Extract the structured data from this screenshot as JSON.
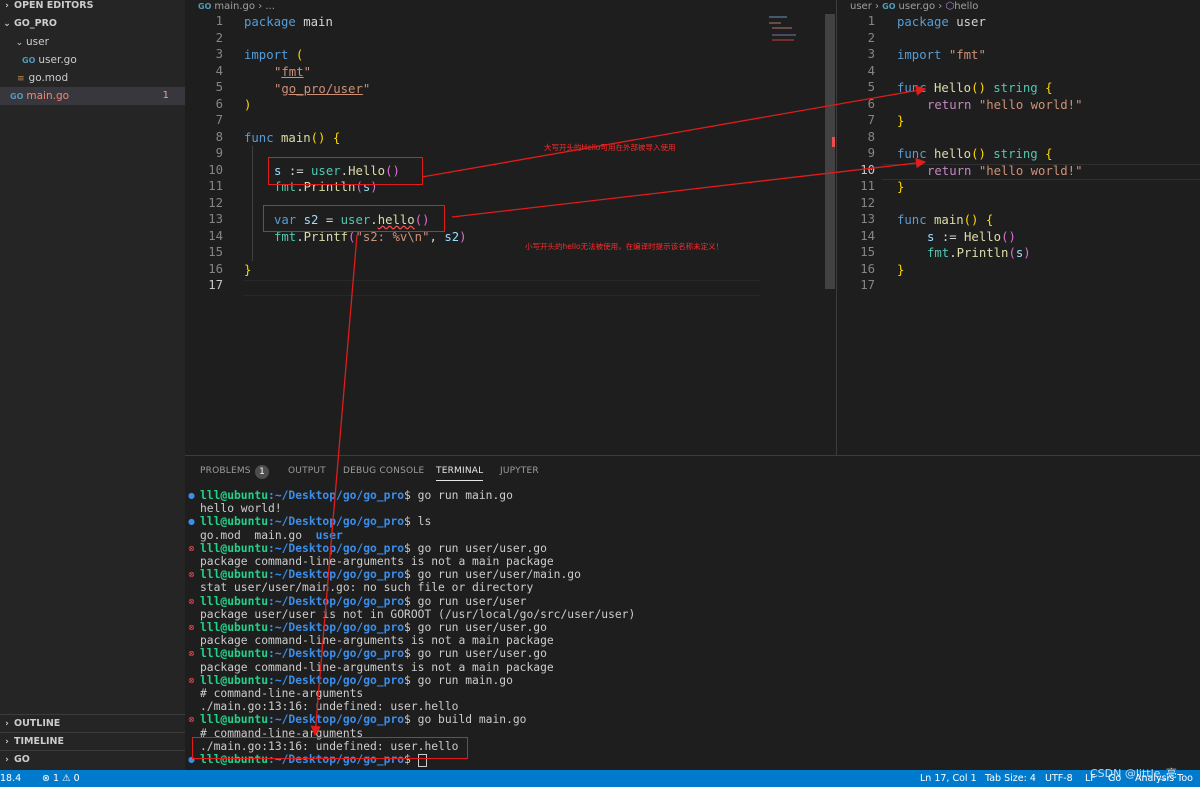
{
  "sidebar": {
    "open_editors": "OPEN EDITORS",
    "project": "GO_PRO",
    "items": [
      {
        "label": "user",
        "type": "folder"
      },
      {
        "label": "user.go",
        "type": "go"
      },
      {
        "label": "go.mod",
        "type": "mod"
      },
      {
        "label": "main.go",
        "type": "go",
        "errors": "1"
      }
    ],
    "outline": "OUTLINE",
    "timeline": "TIMELINE",
    "go": "GO"
  },
  "left_editor": {
    "breadcrumb_file": "main.go",
    "breadcrumb_rest": "...",
    "line_numbers": [
      "1",
      "2",
      "3",
      "4",
      "5",
      "6",
      "7",
      "8",
      "9",
      "10",
      "11",
      "12",
      "13",
      "14",
      "15",
      "16",
      "17"
    ]
  },
  "right_editor": {
    "breadcrumb_folder": "user",
    "breadcrumb_file": "user.go",
    "breadcrumb_symbol": "hello",
    "line_numbers": [
      "1",
      "2",
      "3",
      "4",
      "5",
      "6",
      "7",
      "8",
      "9",
      "10",
      "11",
      "12",
      "13",
      "14",
      "15",
      "16",
      "17"
    ]
  },
  "annotations": {
    "upper": "大写开头的Hello可用在外部被导入使用",
    "lower": "小写开头的hello无法被使用，在编译时提示该名称未定义！"
  },
  "panel": {
    "tabs": [
      "PROBLEMS",
      "OUTPUT",
      "DEBUG CONSOLE",
      "TERMINAL",
      "JUPYTER"
    ],
    "problems_count": "1",
    "active_tab": "TERMINAL",
    "prompt_user": "lll@ubuntu",
    "prompt_path": ":~/Desktop/go/go_pro",
    "terminal": [
      {
        "status": "ok",
        "cmd": "$ go run main.go",
        "out": [
          "hello world!"
        ]
      },
      {
        "status": "ok",
        "cmd": "$ ls",
        "out": [
          "go.mod  main.go  "
        ],
        "dir": "user"
      },
      {
        "status": "err",
        "cmd": "$ go run user/user.go",
        "out": [
          "package command-line-arguments is not a main package"
        ]
      },
      {
        "status": "err",
        "cmd": "$ go run user/user/main.go",
        "out": [
          "stat user/user/main.go: no such file or directory"
        ]
      },
      {
        "status": "err",
        "cmd": "$ go run user/user",
        "out": [
          "package user/user is not in GOROOT (/usr/local/go/src/user/user)"
        ]
      },
      {
        "status": "err",
        "cmd": "$ go run user/user.go",
        "out": [
          "package command-line-arguments is not a main package"
        ]
      },
      {
        "status": "err",
        "cmd": "$ go run user/user.go",
        "out": [
          "package command-line-arguments is not a main package"
        ]
      },
      {
        "status": "err",
        "cmd": "$ go run main.go",
        "out": [
          "# command-line-arguments",
          "./main.go:13:16: undefined: user.hello"
        ]
      },
      {
        "status": "err",
        "cmd": "$ go build main.go",
        "out": [
          "# command-line-arguments",
          "./main.go:13:16: undefined: user.hello"
        ]
      },
      {
        "status": "ok",
        "cmd": "$ ",
        "out": []
      }
    ]
  },
  "status_bar": {
    "left_version": "18.4",
    "problems": "⊗ 1 ⚠ 0",
    "cursor": "Ln 17, Col 1",
    "tab_size": "Tab Size: 4",
    "encoding": "UTF-8",
    "eol": "LF",
    "language": "Go",
    "analysis": "Analysis Too",
    "watermark": "CSDN @little_亮"
  }
}
